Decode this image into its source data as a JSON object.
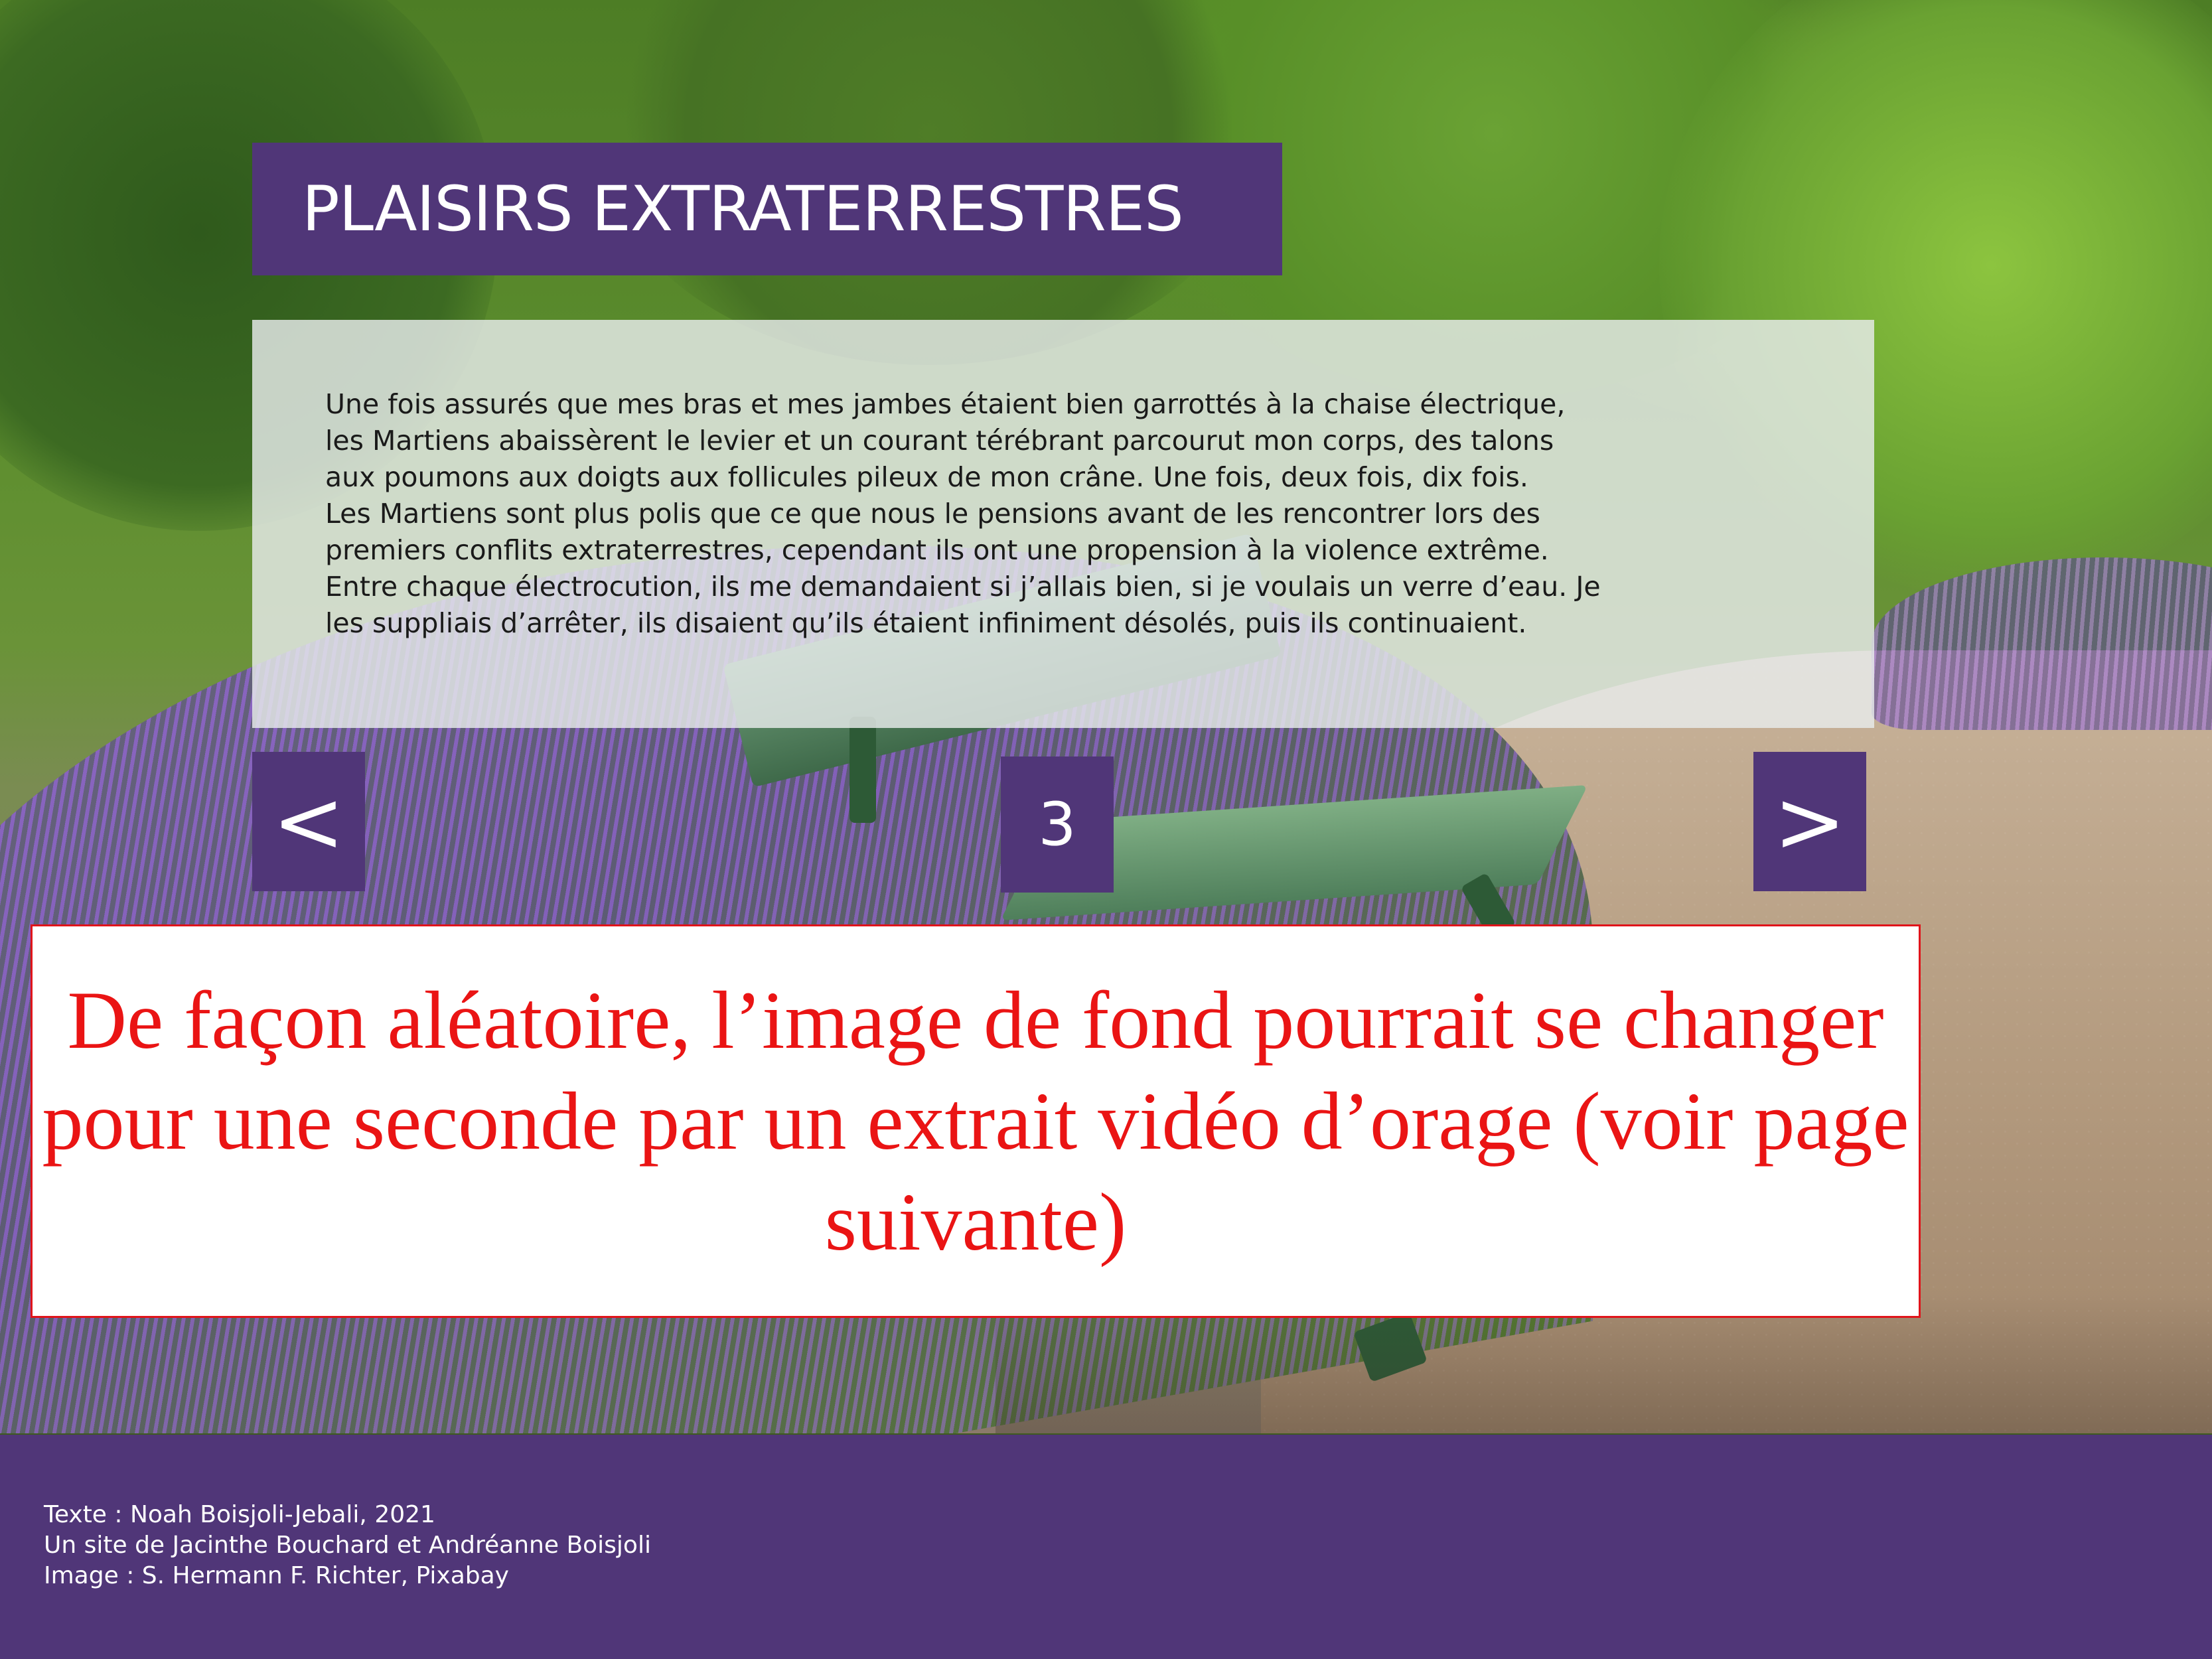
{
  "header": {
    "title": "PLAISIRS EXTRATERRESTRES"
  },
  "story": {
    "text": "Une fois assurés que mes bras et mes jambes étaient bien garrottés à la chaise électrique,\nles Martiens abaissèrent le levier et un courant térébrant parcourut mon corps, des talons\naux poumons aux doigts aux follicules pileux de mon crâne. Une fois, deux fois, dix fois.\nLes Martiens sont plus polis que ce que nous le pensions avant de les rencontrer lors des\npremiers conflits extraterrestres, cependant ils ont une propension à la violence extrême.\nEntre chaque électrocution, ils me demandaient si j’allais bien, si je voulais un verre d’eau. Je\nles suppliais d’arrêter, ils disaient qu’ils étaient infiniment désolés, puis ils continuaient."
  },
  "navigation": {
    "prev_label": "<",
    "next_label": ">",
    "page_number": "3"
  },
  "note": {
    "text": "De façon aléatoire, l’image de fond pourrait se changer pour une seconde par un extrait vidéo d’orage (voir page suivante)",
    "color": "#ea1414"
  },
  "footer": {
    "credits": [
      "Texte : Noah Boisjoli-Jebali, 2021",
      "Un site de Jacinthe Bouchard et Andréanne Boisjoli",
      "Image : S. Hermann  F. Richter, Pixabay"
    ]
  },
  "theme": {
    "accent": "#503678",
    "text_panel_bg": "#e8ecec"
  },
  "background": {
    "image_subject": "garden-lavender-bench"
  }
}
